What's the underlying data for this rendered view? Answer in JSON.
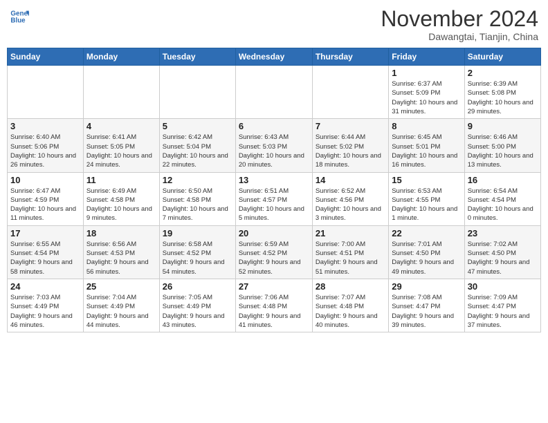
{
  "header": {
    "logo_line1": "General",
    "logo_line2": "Blue",
    "month": "November 2024",
    "location": "Dawangtai, Tianjin, China"
  },
  "weekdays": [
    "Sunday",
    "Monday",
    "Tuesday",
    "Wednesday",
    "Thursday",
    "Friday",
    "Saturday"
  ],
  "weeks": [
    [
      {
        "day": "",
        "info": ""
      },
      {
        "day": "",
        "info": ""
      },
      {
        "day": "",
        "info": ""
      },
      {
        "day": "",
        "info": ""
      },
      {
        "day": "",
        "info": ""
      },
      {
        "day": "1",
        "info": "Sunrise: 6:37 AM\nSunset: 5:09 PM\nDaylight: 10 hours and 31 minutes."
      },
      {
        "day": "2",
        "info": "Sunrise: 6:39 AM\nSunset: 5:08 PM\nDaylight: 10 hours and 29 minutes."
      }
    ],
    [
      {
        "day": "3",
        "info": "Sunrise: 6:40 AM\nSunset: 5:06 PM\nDaylight: 10 hours and 26 minutes."
      },
      {
        "day": "4",
        "info": "Sunrise: 6:41 AM\nSunset: 5:05 PM\nDaylight: 10 hours and 24 minutes."
      },
      {
        "day": "5",
        "info": "Sunrise: 6:42 AM\nSunset: 5:04 PM\nDaylight: 10 hours and 22 minutes."
      },
      {
        "day": "6",
        "info": "Sunrise: 6:43 AM\nSunset: 5:03 PM\nDaylight: 10 hours and 20 minutes."
      },
      {
        "day": "7",
        "info": "Sunrise: 6:44 AM\nSunset: 5:02 PM\nDaylight: 10 hours and 18 minutes."
      },
      {
        "day": "8",
        "info": "Sunrise: 6:45 AM\nSunset: 5:01 PM\nDaylight: 10 hours and 16 minutes."
      },
      {
        "day": "9",
        "info": "Sunrise: 6:46 AM\nSunset: 5:00 PM\nDaylight: 10 hours and 13 minutes."
      }
    ],
    [
      {
        "day": "10",
        "info": "Sunrise: 6:47 AM\nSunset: 4:59 PM\nDaylight: 10 hours and 11 minutes."
      },
      {
        "day": "11",
        "info": "Sunrise: 6:49 AM\nSunset: 4:58 PM\nDaylight: 10 hours and 9 minutes."
      },
      {
        "day": "12",
        "info": "Sunrise: 6:50 AM\nSunset: 4:58 PM\nDaylight: 10 hours and 7 minutes."
      },
      {
        "day": "13",
        "info": "Sunrise: 6:51 AM\nSunset: 4:57 PM\nDaylight: 10 hours and 5 minutes."
      },
      {
        "day": "14",
        "info": "Sunrise: 6:52 AM\nSunset: 4:56 PM\nDaylight: 10 hours and 3 minutes."
      },
      {
        "day": "15",
        "info": "Sunrise: 6:53 AM\nSunset: 4:55 PM\nDaylight: 10 hours and 1 minute."
      },
      {
        "day": "16",
        "info": "Sunrise: 6:54 AM\nSunset: 4:54 PM\nDaylight: 10 hours and 0 minutes."
      }
    ],
    [
      {
        "day": "17",
        "info": "Sunrise: 6:55 AM\nSunset: 4:54 PM\nDaylight: 9 hours and 58 minutes."
      },
      {
        "day": "18",
        "info": "Sunrise: 6:56 AM\nSunset: 4:53 PM\nDaylight: 9 hours and 56 minutes."
      },
      {
        "day": "19",
        "info": "Sunrise: 6:58 AM\nSunset: 4:52 PM\nDaylight: 9 hours and 54 minutes."
      },
      {
        "day": "20",
        "info": "Sunrise: 6:59 AM\nSunset: 4:52 PM\nDaylight: 9 hours and 52 minutes."
      },
      {
        "day": "21",
        "info": "Sunrise: 7:00 AM\nSunset: 4:51 PM\nDaylight: 9 hours and 51 minutes."
      },
      {
        "day": "22",
        "info": "Sunrise: 7:01 AM\nSunset: 4:50 PM\nDaylight: 9 hours and 49 minutes."
      },
      {
        "day": "23",
        "info": "Sunrise: 7:02 AM\nSunset: 4:50 PM\nDaylight: 9 hours and 47 minutes."
      }
    ],
    [
      {
        "day": "24",
        "info": "Sunrise: 7:03 AM\nSunset: 4:49 PM\nDaylight: 9 hours and 46 minutes."
      },
      {
        "day": "25",
        "info": "Sunrise: 7:04 AM\nSunset: 4:49 PM\nDaylight: 9 hours and 44 minutes."
      },
      {
        "day": "26",
        "info": "Sunrise: 7:05 AM\nSunset: 4:49 PM\nDaylight: 9 hours and 43 minutes."
      },
      {
        "day": "27",
        "info": "Sunrise: 7:06 AM\nSunset: 4:48 PM\nDaylight: 9 hours and 41 minutes."
      },
      {
        "day": "28",
        "info": "Sunrise: 7:07 AM\nSunset: 4:48 PM\nDaylight: 9 hours and 40 minutes."
      },
      {
        "day": "29",
        "info": "Sunrise: 7:08 AM\nSunset: 4:47 PM\nDaylight: 9 hours and 39 minutes."
      },
      {
        "day": "30",
        "info": "Sunrise: 7:09 AM\nSunset: 4:47 PM\nDaylight: 9 hours and 37 minutes."
      }
    ]
  ]
}
